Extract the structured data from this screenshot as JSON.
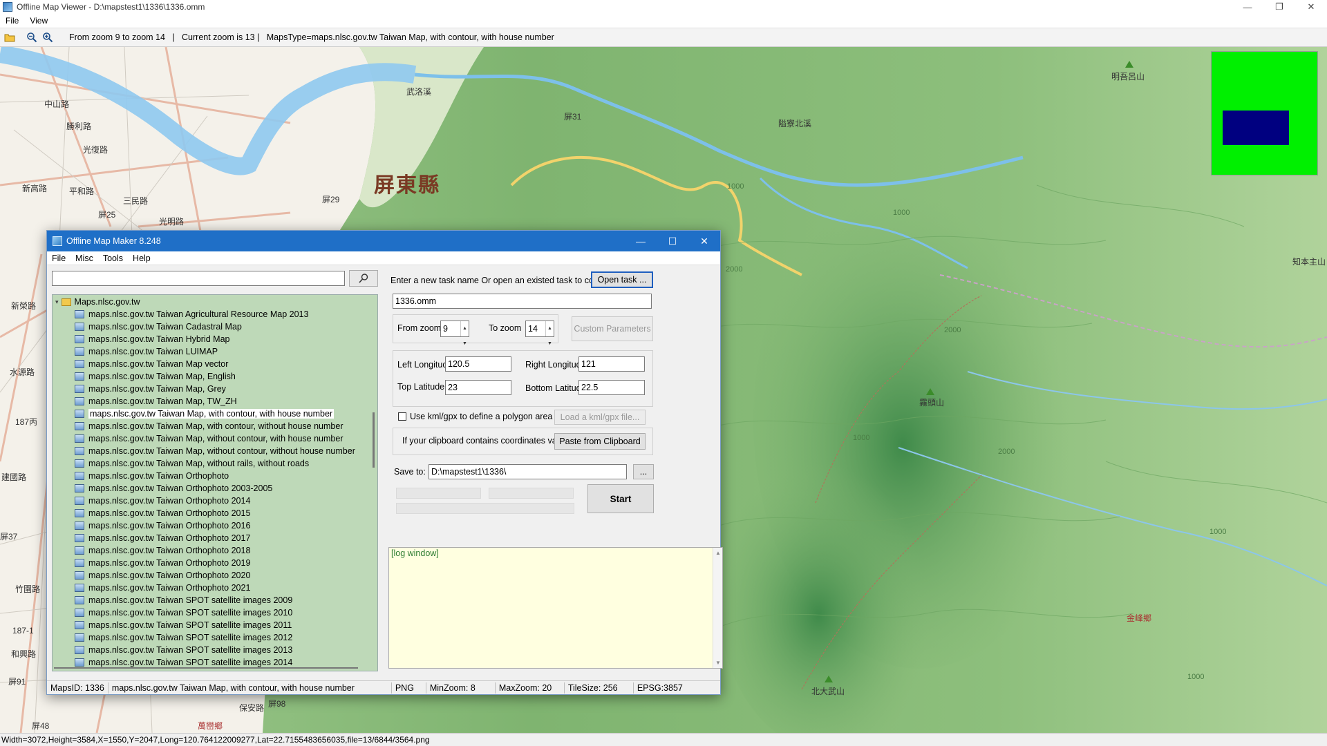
{
  "window": {
    "title": "Offline Map Viewer - D:\\mapstest1\\1336\\1336.omm",
    "minimize": "—",
    "maximize": "❐",
    "close": "✕"
  },
  "menu": {
    "file": "File",
    "view": "View"
  },
  "toolbar": {
    "info": "From zoom 9 to zoom 14   |   Current zoom is 13 |   MapsType=maps.nlsc.gov.tw Taiwan Map, with contour, with house number"
  },
  "map": {
    "county_label": "屏東縣",
    "labels": [
      "武洛溪",
      "中山路",
      "勝利路",
      "光復路",
      "新高路",
      "平和路",
      "三民路",
      "光明路",
      "新榮路",
      "水源路",
      "屏31",
      "屏29",
      "屏25",
      "隘寮北溪",
      "明吾呂山",
      "知本主山",
      "霧頭山",
      "北大武山",
      "金峰鄉",
      "萬巒鄉",
      "保安路",
      "屏98",
      "屏48",
      "屏91",
      "屏37",
      "187丙",
      "187-1",
      "竹園路",
      "和興路",
      "建國路",
      "1000",
      "2000",
      "1000",
      "2000",
      "1000",
      "2000",
      "1000",
      "1000"
    ]
  },
  "statusbar": {
    "text": "Width=3072,Height=3584,X=1550,Y=2047,Long=120.764122009277,Lat=22.7155483656035,file=13/6844/3564.png"
  },
  "dialog": {
    "title": "Offline Map Maker 8.248",
    "menu": [
      "File",
      "Misc",
      "Tools",
      "Help"
    ],
    "search": {
      "value": "",
      "placeholder": ""
    },
    "tree": {
      "root": "Maps.nlsc.gov.tw",
      "items": [
        "maps.nlsc.gov.tw Taiwan Agricultural Resource Map 2013",
        "maps.nlsc.gov.tw Taiwan Cadastral Map",
        "maps.nlsc.gov.tw Taiwan Hybrid Map",
        "maps.nlsc.gov.tw Taiwan LUIMAP",
        "maps.nlsc.gov.tw Taiwan Map vector",
        "maps.nlsc.gov.tw Taiwan Map, English",
        "maps.nlsc.gov.tw Taiwan Map, Grey",
        "maps.nlsc.gov.tw Taiwan Map, TW_ZH",
        "maps.nlsc.gov.tw Taiwan Map, with contour, with house number",
        "maps.nlsc.gov.tw Taiwan Map, with contour, without house number",
        "maps.nlsc.gov.tw Taiwan Map, without contour, with house number",
        "maps.nlsc.gov.tw Taiwan Map, without contour, without house number",
        "maps.nlsc.gov.tw Taiwan Map, without rails, without roads",
        "maps.nlsc.gov.tw Taiwan Orthophoto",
        "maps.nlsc.gov.tw Taiwan Orthophoto 2003-2005",
        "maps.nlsc.gov.tw Taiwan Orthophoto 2014",
        "maps.nlsc.gov.tw Taiwan Orthophoto 2015",
        "maps.nlsc.gov.tw Taiwan Orthophoto 2016",
        "maps.nlsc.gov.tw Taiwan Orthophoto 2017",
        "maps.nlsc.gov.tw Taiwan Orthophoto 2018",
        "maps.nlsc.gov.tw Taiwan Orthophoto 2019",
        "maps.nlsc.gov.tw Taiwan Orthophoto 2020",
        "maps.nlsc.gov.tw Taiwan Orthophoto 2021",
        "maps.nlsc.gov.tw Taiwan SPOT satellite images 2009",
        "maps.nlsc.gov.tw Taiwan SPOT satellite images 2010",
        "maps.nlsc.gov.tw Taiwan SPOT satellite images 2011",
        "maps.nlsc.gov.tw Taiwan SPOT satellite images 2012",
        "maps.nlsc.gov.tw Taiwan SPOT satellite images 2013",
        "maps.nlsc.gov.tw Taiwan SPOT satellite images 2014"
      ],
      "selected_index": 8
    },
    "task_prompt": "Enter a new task name Or open an existed task to continue:",
    "open_task_button": "Open task ...",
    "task_name": "1336.omm",
    "from_zoom_label": "From zoom",
    "from_zoom_value": "9",
    "to_zoom_label": "To zoom",
    "to_zoom_value": "14",
    "custom_params_button": "Custom Parameters",
    "left_longitude_label": "Left Longitude",
    "left_longitude_value": "120.5",
    "right_longitude_label": "Right Longitude",
    "right_longitude_value": "121",
    "top_latitude_label": "Top Latitude",
    "top_latitude_value": "23",
    "bottom_latitude_label": "Bottom Latitude",
    "bottom_latitude_value": "22.5",
    "kml_checkbox_label": "Use kml/gpx to define a polygon area",
    "kml_checked": false,
    "load_kml_button": "Load a kml/gpx file...",
    "clipboard_label": "If your clipboard contains coordinates values:",
    "paste_button": "Paste from Clipboard",
    "save_to_label": "Save to:",
    "save_to_value": "D:\\mapstest1\\1336\\",
    "browse_button": "...",
    "start_button": "Start",
    "log_text": "[log window]",
    "status": {
      "maps_id": "MapsID: 1336",
      "maps_name": "maps.nlsc.gov.tw Taiwan Map, with contour, with house number",
      "format": "PNG",
      "min_zoom": "MinZoom: 8",
      "max_zoom": "MaxZoom: 20",
      "tile_size": "TileSize: 256",
      "epsg": "EPSG:3857"
    }
  },
  "colors": {
    "dialog_titlebar": "#1f6fc7",
    "tree_background": "#bed9b8",
    "log_background": "#ffffe0",
    "minimap_background": "#00f000",
    "minimap_view": "#000080"
  }
}
